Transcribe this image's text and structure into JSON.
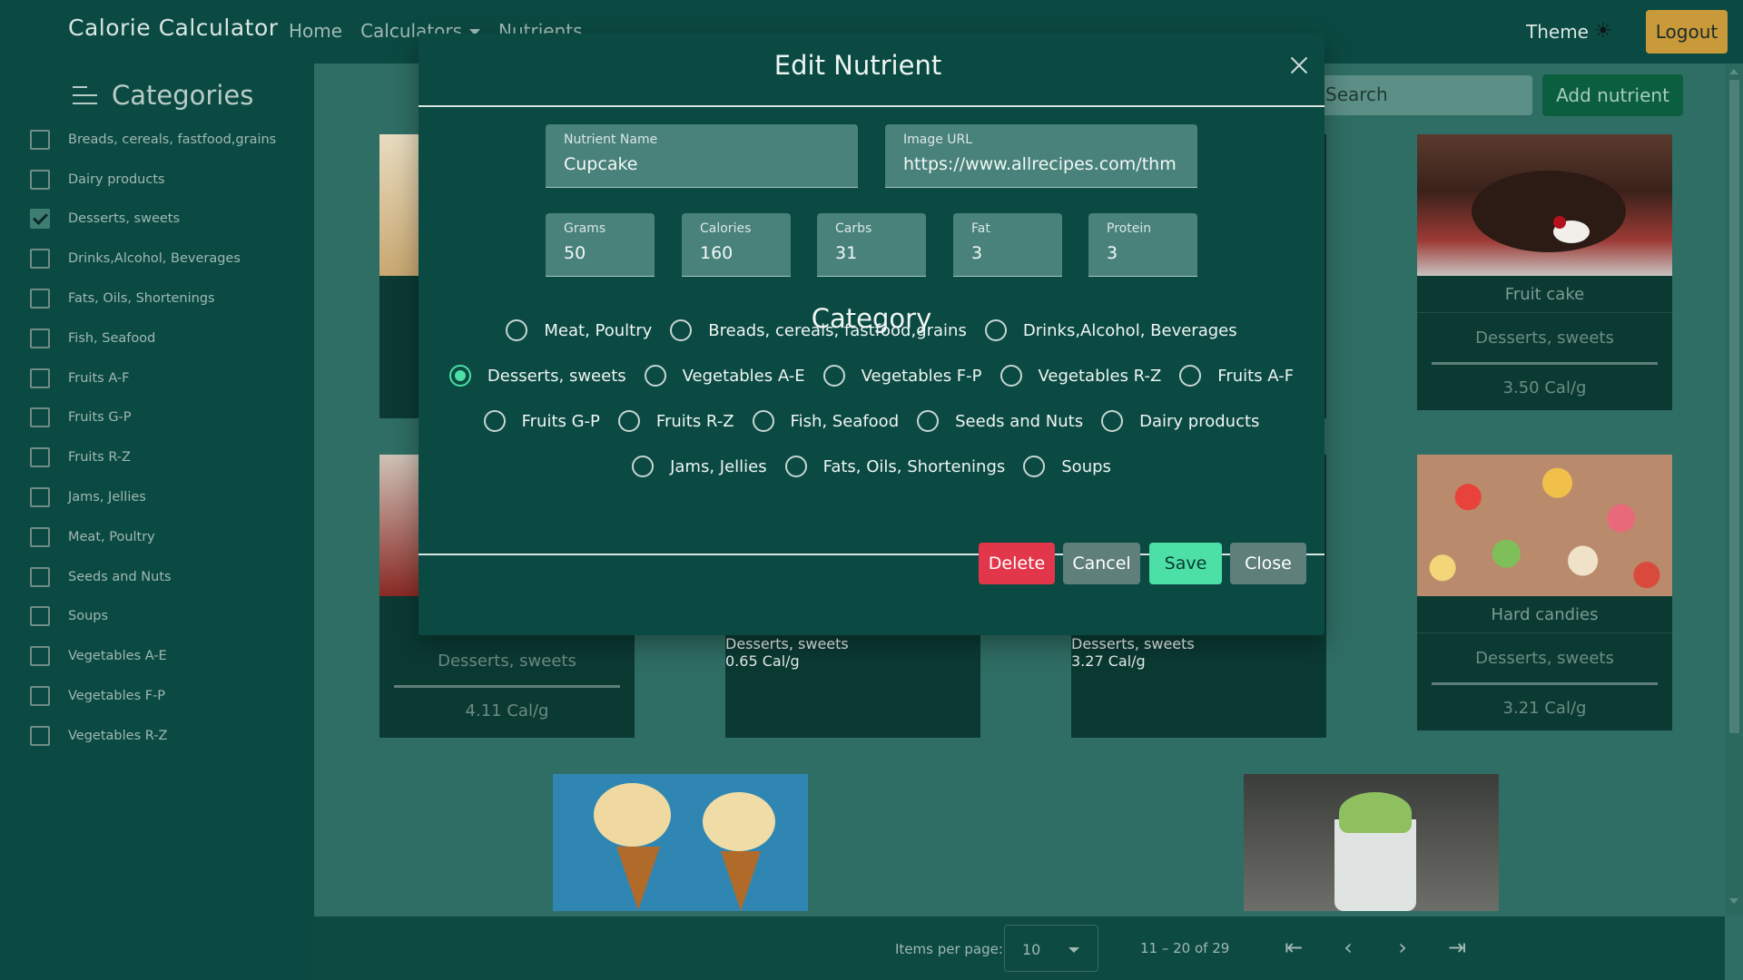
{
  "app": {
    "title": "Calorie Calculator"
  },
  "nav": {
    "home": "Home",
    "calculators": "Calculators",
    "nutrients": "Nutrients",
    "theme": "Theme",
    "logout": "Logout"
  },
  "sidebar": {
    "title": "Categories",
    "items": [
      {
        "label": "Breads, cereals, fastfood,grains",
        "checked": false
      },
      {
        "label": "Dairy products",
        "checked": false
      },
      {
        "label": "Desserts, sweets",
        "checked": true
      },
      {
        "label": "Drinks,Alcohol, Beverages",
        "checked": false
      },
      {
        "label": "Fats, Oils, Shortenings",
        "checked": false
      },
      {
        "label": "Fish, Seafood",
        "checked": false
      },
      {
        "label": "Fruits A-F",
        "checked": false
      },
      {
        "label": "Fruits G-P",
        "checked": false
      },
      {
        "label": "Fruits R-Z",
        "checked": false
      },
      {
        "label": "Jams, Jellies",
        "checked": false
      },
      {
        "label": "Meat, Poultry",
        "checked": false
      },
      {
        "label": "Seeds and Nuts",
        "checked": false
      },
      {
        "label": "Soups",
        "checked": false
      },
      {
        "label": "Vegetables A-E",
        "checked": false
      },
      {
        "label": "Vegetables F-P",
        "checked": false
      },
      {
        "label": "Vegetables R-Z",
        "checked": false
      }
    ]
  },
  "toolbar": {
    "search_placeholder": "Search",
    "add_label": "Add nutrient"
  },
  "cards": [
    {
      "name": "Fruit cake",
      "category": "Desserts, sweets",
      "cal": "3.50 Cal/g"
    },
    {
      "name": "Hard candies",
      "category": "Desserts, sweets",
      "cal": "3.21 Cal/g"
    },
    {
      "category": "Desserts, sweets",
      "cal": "4.11 Cal/g"
    },
    {
      "category": "Desserts, sweets",
      "cal": "0.65 Cal/g"
    },
    {
      "category": "Desserts, sweets",
      "cal": "3.27 Cal/g"
    }
  ],
  "pager": {
    "items_per_page_label": "Items per page:",
    "items_per_page": "10",
    "range": "11 – 20 of 29"
  },
  "modal": {
    "title": "Edit Nutrient",
    "fields": {
      "name": {
        "label": "Nutrient Name",
        "value": "Cupcake"
      },
      "image": {
        "label": "Image URL",
        "value": "https://www.allrecipes.com/thm"
      },
      "grams": {
        "label": "Grams",
        "value": "50"
      },
      "calories": {
        "label": "Calories",
        "value": "160"
      },
      "carbs": {
        "label": "Carbs",
        "value": "31"
      },
      "fat": {
        "label": "Fat",
        "value": "3"
      },
      "protein": {
        "label": "Protein",
        "value": "3"
      }
    },
    "category_title": "Category",
    "category_rows": [
      [
        "Meat, Poultry",
        "Breads, cereals, fastfood,grains",
        "Drinks,Alcohol, Beverages"
      ],
      [
        "Desserts, sweets",
        "Vegetables A-E",
        "Vegetables F-P",
        "Vegetables R-Z",
        "Fruits A-F"
      ],
      [
        "Fruits G-P",
        "Fruits R-Z",
        "Fish, Seafood",
        "Seeds and Nuts",
        "Dairy products"
      ],
      [
        "Jams, Jellies",
        "Fats, Oils, Shortenings",
        "Soups"
      ]
    ],
    "selected_category": "Desserts, sweets",
    "buttons": {
      "delete": "Delete",
      "cancel": "Cancel",
      "save": "Save",
      "close": "Close"
    }
  },
  "colors": {
    "accent": "#4ce0a6",
    "danger": "#e2374b",
    "surface": "#0b4a42",
    "logout": "#c99a3a"
  }
}
